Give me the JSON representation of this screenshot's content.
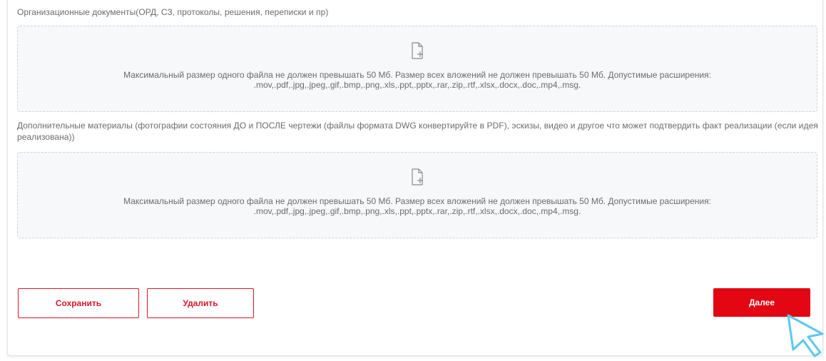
{
  "sections": [
    {
      "label": "Организационные документы(ОРД, СЗ, протоколы, решения, переписки и пр)",
      "dropzone": {
        "icon": "file-add-icon",
        "hint": "Максимальный размер одного файла не должен превышать 50 Мб. Размер всех вложений не должен превышать 50 Мб. Допустимые расширения: .mov,.pdf,.jpg,.jpeg,.gif,.bmp,.png,.xls,.ppt,.pptx,.rar,.zip,.rtf,.xlsx,.docx,.doc,.mp4,.msg."
      }
    },
    {
      "label": "Дополнительные материалы (фотографии состояния ДО и ПОСЛЕ чертежи (файлы формата DWG конвертируйте в PDF), эскизы, видео и другое что может подтвердить факт реализации (если идея реализована))",
      "dropzone": {
        "icon": "file-add-icon",
        "hint": "Максимальный размер одного файла не должен превышать 50 Мб. Размер всех вложений не должен превышать 50 Мб. Допустимые расширения: .mov,.pdf,.jpg,.jpeg,.gif,.bmp,.png,.xls,.ppt,.pptx,.rar,.zip,.rtf,.xlsx,.docx,.doc,.mp4,.msg."
      }
    }
  ],
  "actions": {
    "save_label": "Сохранить",
    "delete_label": "Удалить",
    "next_label": "Далее"
  },
  "colors": {
    "accent": "#e30613",
    "outline": "#d7182a",
    "cursor": "#5bc8ef"
  },
  "cursor_icon": "pointer-cursor-icon"
}
